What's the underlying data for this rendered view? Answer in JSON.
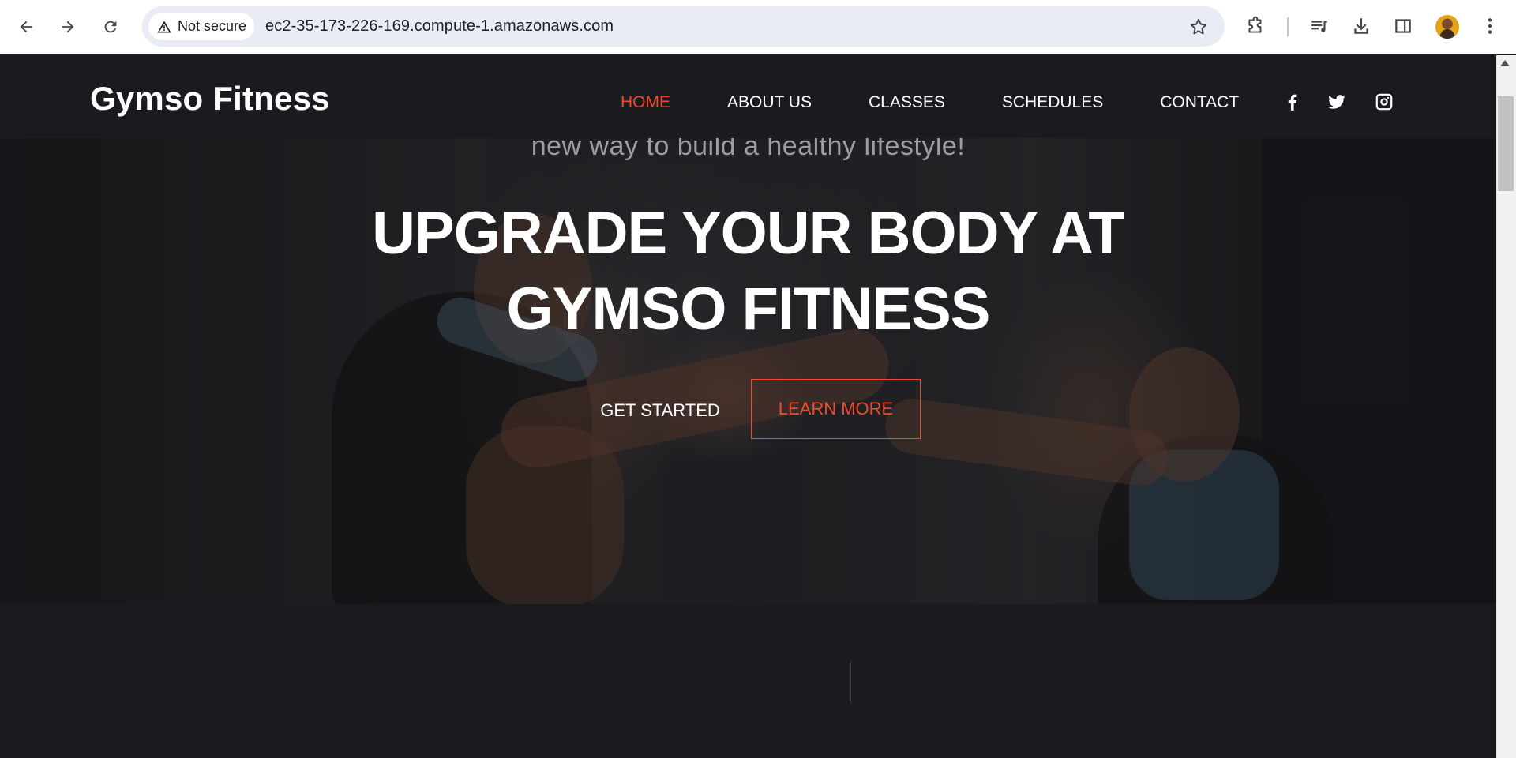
{
  "browser": {
    "security_label": "Not secure",
    "url": "ec2-35-173-226-169.compute-1.amazonaws.com",
    "icons": [
      "back-arrow-icon",
      "forward-arrow-icon",
      "reload-icon",
      "warning-triangle-icon",
      "bookmark-star-icon",
      "extensions-puzzle-icon",
      "media-queue-icon",
      "download-icon",
      "side-panel-icon",
      "profile-avatar",
      "more-vert-icon"
    ]
  },
  "site": {
    "brand": "Gymso Fitness",
    "nav": {
      "home": "HOME",
      "about": "ABOUT US",
      "classes": "CLASSES",
      "schedules": "SCHEDULES",
      "contact": "CONTACT"
    },
    "social_icons": [
      "facebook-icon",
      "twitter-icon",
      "instagram-icon"
    ],
    "accent_color": "#ef4a2b"
  },
  "hero": {
    "tagline": "new way to build a healthy lifestyle!",
    "headline_line1": "UPGRADE YOUR BODY AT",
    "headline_line2": "GYMSO FITNESS",
    "primary_button": "GET STARTED",
    "secondary_button": "LEARN MORE"
  }
}
